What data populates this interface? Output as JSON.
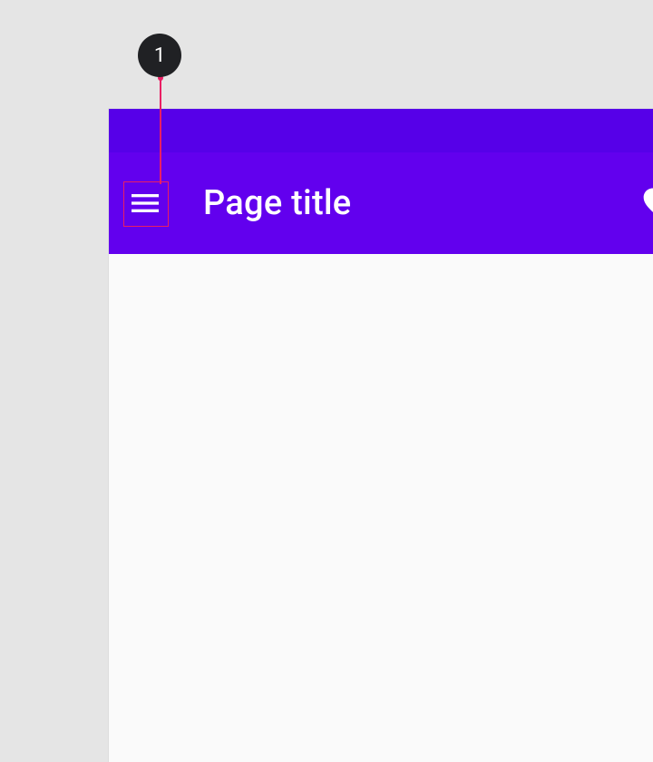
{
  "callout": {
    "number": "1"
  },
  "appbar": {
    "title": "Page title"
  },
  "colors": {
    "status_bar": "#5600e8",
    "app_bar": "#6200ee",
    "callout_highlight": "#e91e63",
    "callout_badge": "#202124",
    "background": "#e5e5e5",
    "surface": "#fafafa"
  },
  "icons": {
    "nav": "menu-icon",
    "action_1": "heart-icon",
    "action_2": "search-icon"
  }
}
